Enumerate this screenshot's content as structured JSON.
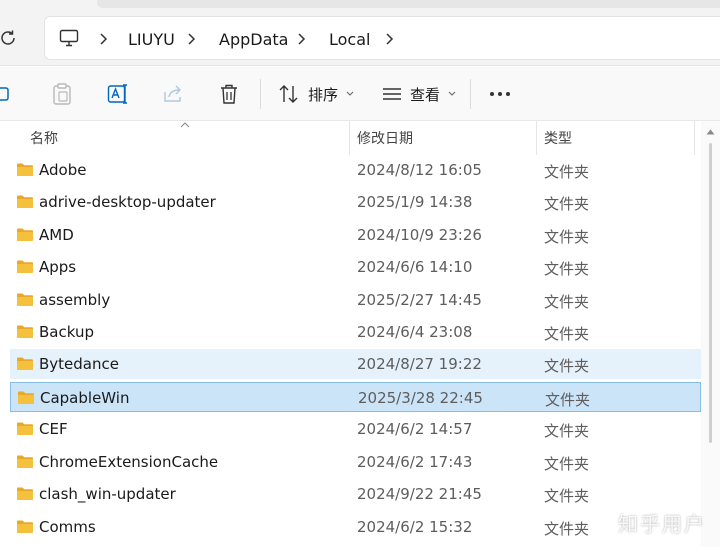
{
  "breadcrumb": {
    "items": [
      "LIUYU",
      "AppData",
      "Local"
    ]
  },
  "toolbar": {
    "sort_label": "排序",
    "view_label": "查看",
    "more_label": "···"
  },
  "columns": {
    "name": "名称",
    "date": "修改日期",
    "type": "类型"
  },
  "rows": [
    {
      "name": "Adobe",
      "date": "2024/8/12 16:05",
      "type": "文件夹"
    },
    {
      "name": "adrive-desktop-updater",
      "date": "2025/1/9 14:38",
      "type": "文件夹"
    },
    {
      "name": "AMD",
      "date": "2024/10/9 23:26",
      "type": "文件夹"
    },
    {
      "name": "Apps",
      "date": "2024/6/6 14:10",
      "type": "文件夹"
    },
    {
      "name": "assembly",
      "date": "2025/2/27 14:45",
      "type": "文件夹"
    },
    {
      "name": "Backup",
      "date": "2024/6/4 23:08",
      "type": "文件夹"
    },
    {
      "name": "Bytedance",
      "date": "2024/8/27 19:22",
      "type": "文件夹"
    },
    {
      "name": "CapableWin",
      "date": "2025/3/28 22:45",
      "type": "文件夹"
    },
    {
      "name": "CEF",
      "date": "2024/6/2 14:57",
      "type": "文件夹"
    },
    {
      "name": "ChromeExtensionCache",
      "date": "2024/6/2 17:43",
      "type": "文件夹"
    },
    {
      "name": "clash_win-updater",
      "date": "2024/9/22 21:45",
      "type": "文件夹"
    },
    {
      "name": "Comms",
      "date": "2024/6/2 15:32",
      "type": "文件夹"
    }
  ],
  "watermark": "知乎用户",
  "colors": {
    "hover_row": "#e5f1fb",
    "selected_row": "#cce4f7",
    "folder": "#f5c13c"
  }
}
